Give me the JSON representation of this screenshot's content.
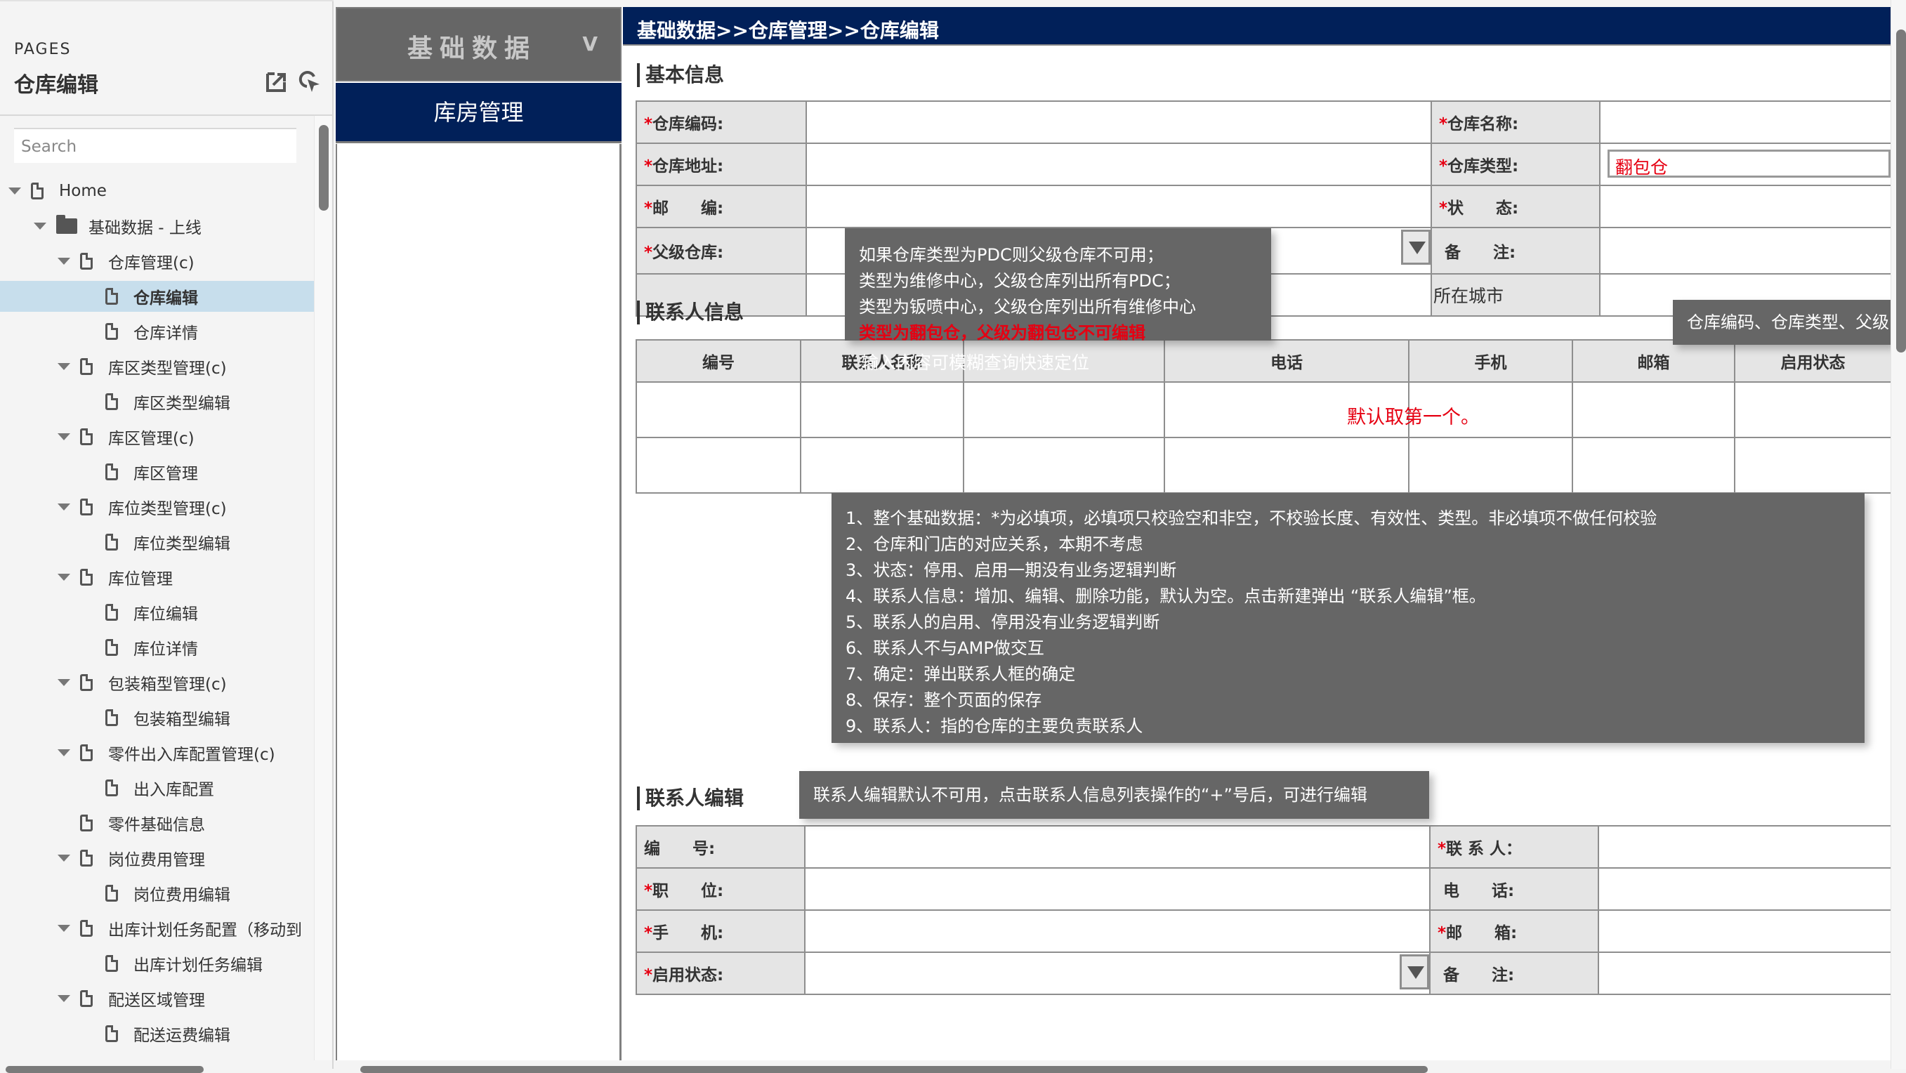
{
  "sidebar": {
    "section_label": "PAGES",
    "page_title": "仓库编辑",
    "search_placeholder": "Search",
    "tree": [
      {
        "label": "Home",
        "level": 0,
        "expanded": true,
        "icon": "file-icon"
      },
      {
        "label": "基础数据 - 上线",
        "level": 1,
        "expanded": true,
        "icon": "folder-icon"
      },
      {
        "label": "仓库管理(c)",
        "level": 2,
        "expanded": true,
        "icon": "file-icon"
      },
      {
        "label": "仓库编辑",
        "level": 3,
        "selected": true,
        "icon": "file-icon"
      },
      {
        "label": "仓库详情",
        "level": 3,
        "icon": "file-icon"
      },
      {
        "label": "库区类型管理(c)",
        "level": 2,
        "expanded": true,
        "icon": "file-icon"
      },
      {
        "label": "库区类型编辑",
        "level": 3,
        "icon": "file-icon"
      },
      {
        "label": "库区管理(c)",
        "level": 2,
        "expanded": true,
        "icon": "file-icon"
      },
      {
        "label": "库区管理",
        "level": 3,
        "icon": "file-icon"
      },
      {
        "label": "库位类型管理(c)",
        "level": 2,
        "expanded": true,
        "icon": "file-icon"
      },
      {
        "label": "库位类型编辑",
        "level": 3,
        "icon": "file-icon"
      },
      {
        "label": "库位管理",
        "level": 2,
        "expanded": true,
        "icon": "file-icon"
      },
      {
        "label": "库位编辑",
        "level": 3,
        "icon": "file-icon"
      },
      {
        "label": "库位详情",
        "level": 3,
        "icon": "file-icon"
      },
      {
        "label": "包装箱型管理(c)",
        "level": 2,
        "expanded": true,
        "icon": "file-icon"
      },
      {
        "label": "包装箱型编辑",
        "level": 3,
        "icon": "file-icon"
      },
      {
        "label": "零件出入库配置管理(c)",
        "level": 2,
        "expanded": true,
        "icon": "file-icon"
      },
      {
        "label": "出入库配置",
        "level": 3,
        "icon": "file-icon"
      },
      {
        "label": "零件基础信息",
        "level": 2,
        "expanded": false,
        "leaf": true,
        "icon": "file-icon"
      },
      {
        "label": "岗位费用管理",
        "level": 2,
        "expanded": true,
        "icon": "file-icon"
      },
      {
        "label": "岗位费用编辑",
        "level": 3,
        "icon": "file-icon"
      },
      {
        "label": "出库计划任务配置（移动到",
        "level": 2,
        "expanded": true,
        "icon": "file-icon"
      },
      {
        "label": "出库计划任务编辑",
        "level": 3,
        "icon": "file-icon"
      },
      {
        "label": "配送区域管理",
        "level": 2,
        "expanded": true,
        "icon": "file-icon"
      },
      {
        "label": "配送运费编辑",
        "level": 3,
        "icon": "file-icon"
      }
    ]
  },
  "nav": {
    "header": "基础数据",
    "header_toggle": "V",
    "active_item": "库房管理"
  },
  "breadcrumb": "基础数据>>仓库管理>>仓库编辑",
  "basic_info": {
    "title": "基本信息",
    "rows": [
      {
        "left_label": "仓库编码:",
        "left_required": true,
        "right_label": "仓库名称:",
        "right_required": true
      },
      {
        "left_label": "仓库地址:",
        "left_required": true,
        "right_label": "仓库类型:",
        "right_required": true,
        "right_label_red": true,
        "right_value": "翻包仓"
      },
      {
        "left_label": "邮　　编:",
        "left_required": true,
        "right_label": "状　　态:",
        "right_required": true
      },
      {
        "left_label": "父级仓库:",
        "left_required": true,
        "left_dropdown": true,
        "right_label": "备　　注:",
        "right_required": false
      },
      {
        "left_label": "",
        "right_label": "所在城市",
        "right_label_red": true
      }
    ]
  },
  "contact_info": {
    "title": "联系人信息",
    "columns": [
      "编号",
      "联系人名称",
      "",
      "电话",
      "手机",
      "邮箱",
      "启用状态"
    ],
    "rows": [
      [
        "",
        "",
        "",
        "",
        "",
        "",
        ""
      ],
      [
        "",
        "",
        "",
        "",
        "",
        "",
        ""
      ]
    ],
    "overlap_note": "输入内容可模糊查询快速定位",
    "default_note": "默认取第一个。"
  },
  "contact_edit": {
    "title": "联系人编辑",
    "rows": [
      {
        "left_label": "编　　号:",
        "left_required": false,
        "right_label": "联 系 人：",
        "right_required": true
      },
      {
        "left_label": "职　　位:",
        "left_required": true,
        "right_label": "电　　话:",
        "right_required": false
      },
      {
        "left_label": "手　　机:",
        "left_required": true,
        "right_label": "邮　　箱:",
        "right_required": true
      },
      {
        "left_label": "启用状态:",
        "left_required": true,
        "left_dropdown": true,
        "right_label": "备　　注:",
        "right_required": false
      }
    ]
  },
  "annotations": {
    "parent_warehouse_tip": [
      {
        "text": "如果仓库类型为PDC则父级仓库不可用；",
        "red": false
      },
      {
        "text": "类型为维修中心，父级仓库列出所有PDC；",
        "red": false
      },
      {
        "text": "类型为钣喷中心，父级仓库列出所有维修中心",
        "red": false
      },
      {
        "text": "类型为翻包仓，父级为翻包仓不可编辑",
        "red": true
      }
    ],
    "right_tip": "仓库编码、仓库类型、父级",
    "notes": [
      "1、整个基础数据：*为必填项，必填项只校验空和非空，不校验长度、有效性、类型。非必填项不做任何校验",
      "2、仓库和门店的对应关系，本期不考虑",
      "3、状态：停用、启用一期没有业务逻辑判断",
      "4、联系人信息：增加、编辑、删除功能，默认为空。点击新建弹出 “联系人编辑”框。",
      "5、联系人的启用、停用没有业务逻辑判断",
      "6、联系人不与AMP做交互",
      "7、确定：弹出联系人框的确定",
      "8、保存：整个页面的保存",
      "9、联系人：指的仓库的主要负责联系人"
    ],
    "contact_edit_tip": "联系人编辑默认不可用，点击联系人信息列表操作的“+”号后，可进行编辑"
  },
  "colors": {
    "brand_navy": "#012059",
    "required_red": "#e60012",
    "tooltip_gray": "#666666",
    "label_bg": "#e5e5e5",
    "selected_row": "#c7deec"
  }
}
